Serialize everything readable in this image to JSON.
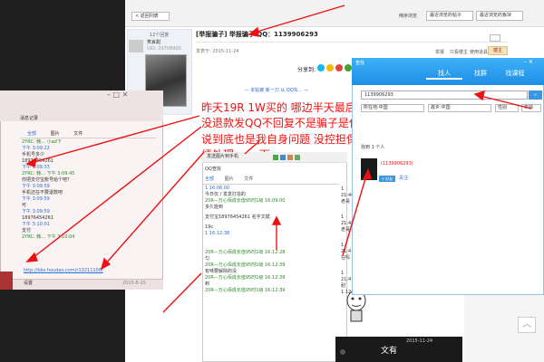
{
  "forum": {
    "back_label": "< 返回列表",
    "nav_links": [
      "倒序浏览",
      "最近浏览的帖子",
      "最近浏览的板块"
    ],
    "reply_count": "12个回复",
    "author_name": "笑哀甜",
    "author_uid": "UID: 20708900",
    "post_title": "[举报骗子] 举报骗子 QQ：1139906293",
    "post_meta": "发表于: 2015-11-24",
    "actions": [
      "举报",
      "只看楼主",
      "使用道具"
    ],
    "floor_button": "楼主",
    "share_label": "分享到:",
    "notice_text": "— 本帖被 新一刀 从 QQ东… —",
    "status_label": "发起"
  },
  "annotation": {
    "line1": "昨天19R 1W买的 哪边半天最后涨价了",
    "line2": "没退款发QQ不回复不是骗子是什么？",
    "line3": "说到底也是我自身问题 没控担保 今天",
    "line4": "烦处理…… 下"
  },
  "qq_chat": {
    "title": "消息记录",
    "tabs": [
      "全部",
      "图片",
      "文件"
    ],
    "messages": [
      {
        "sender": "2YRC: 韩... 小ad下",
        "time": "下午 3:09:22",
        "text": "手机号多少"
      },
      {
        "sender": "",
        "time": "",
        "text": "18976454261"
      },
      {
        "sender": "",
        "time": "下午 3:09:33",
        "text": ""
      },
      {
        "sender": "2YRC: 韩... 下午 3:09:45",
        "time": "",
        "text": "你把支付宝账号给个吧？"
      },
      {
        "sender": "",
        "time": "下午 3:09:59",
        "text": "手机还在不要退款吧"
      },
      {
        "sender": "",
        "time": "下午 3:09:59",
        "text": "可"
      },
      {
        "sender": "",
        "time": "下午 3:09:59",
        "text": "18976454261"
      },
      {
        "sender": "",
        "time": "下午 3:10:01",
        "text": "支付"
      },
      {
        "sender": "2YRC: 韩... 下午 3:10:04",
        "time": "",
        "text": ""
      }
    ],
    "link": "http://bbs.houdao.com/r13211108/",
    "footer_left": "设置",
    "footer_date": "2015-8-15"
  },
  "mobile": {
    "header": "发送图片到手机",
    "contact_label": "QQ查找",
    "tabs": [
      "全部",
      "图片",
      "文件"
    ],
    "date1": "1 16:06:00",
    "note1": "今日仅 / 发发打造的",
    "msg1": "多久能到",
    "msg2": "支付宝18976454261 名字文斌",
    "msg3": "19c",
    "time2": "1 16:12:38",
    "user_line1": "20R—万心佰成长值95时1级 16:09:00",
    "user_line2": "20R—万心佰成长值95时1级 16:12:28",
    "user_line3": "20R—万心佰成长值95时1级 16:12:39",
    "user_line4": "20R—万心佰成长值95时1级 16:12:39",
    "user_line5": "20R—万心佰成长值95时1级 16:12:39",
    "msg4": "匀",
    "msg5": "有味要解除的没",
    "msg6": "到",
    "side_times": [
      "1 21:40",
      "1 21:40",
      "1 21:4",
      "1 21:4",
      "1 12:"
    ],
    "side_msgs": [
      "老哥",
      "老哥",
      "在吗",
      "耐"
    ],
    "bottom_date": "2015-11-24",
    "bottom_label": "文有"
  },
  "qq_find": {
    "title": "查找",
    "tabs": [
      "找人",
      "找群",
      "找课程"
    ],
    "search_value": "1139906293",
    "filters": [
      "所在地:中国",
      "故乡:中国",
      "性别",
      "年龄"
    ],
    "result_count": "找到 1 个人",
    "result_id": "(1139906293)",
    "add_button": "+ 好友",
    "more_label": "关注"
  },
  "colors": {
    "annotation_red": "#e11111",
    "qq_blue": "#2a8fe6",
    "link_blue": "#2a6fd2"
  }
}
